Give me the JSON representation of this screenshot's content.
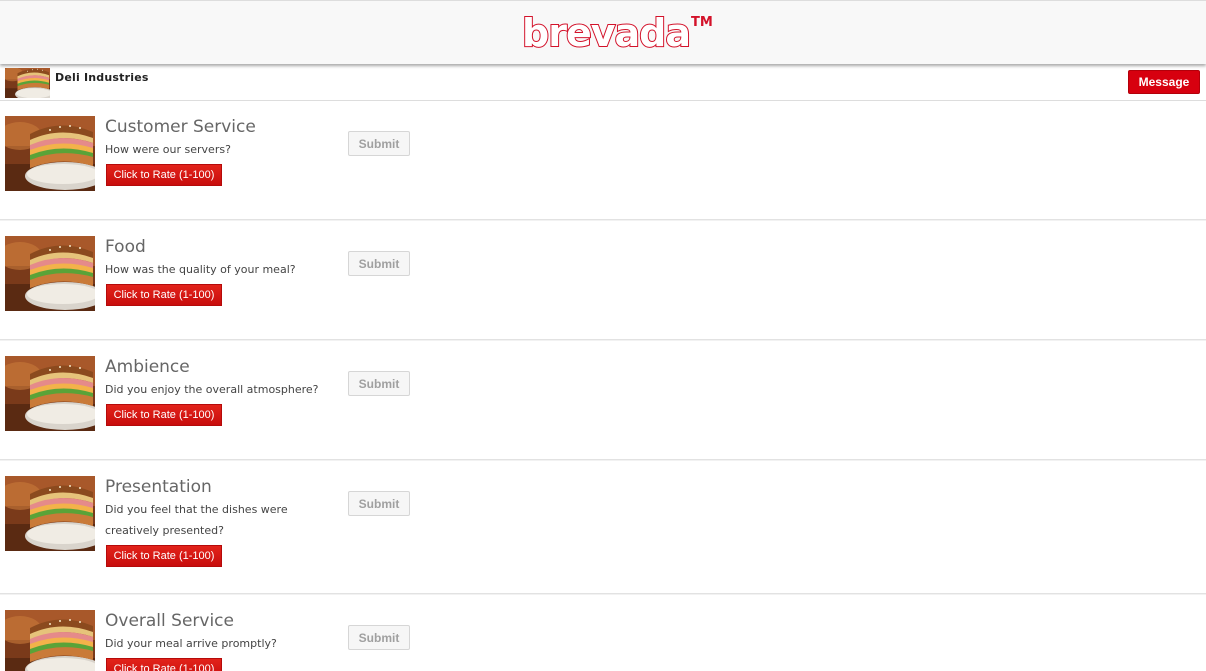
{
  "header": {
    "logo_text": "brevada",
    "logo_tm": "TM"
  },
  "business": {
    "name": "Deli Industries",
    "message_label": "Message"
  },
  "colors": {
    "brand_red": "#d3122a",
    "button_red": "#d7000f",
    "submit_gray": "#a0a0a0"
  },
  "items": [
    {
      "title": "Customer Service",
      "question": "How were our servers?",
      "rate_label": "Click to Rate (1-100)",
      "submit_label": "Submit"
    },
    {
      "title": "Food",
      "question": "How was the quality of your meal?",
      "rate_label": "Click to Rate (1-100)",
      "submit_label": "Submit"
    },
    {
      "title": "Ambience",
      "question": "Did you enjoy the overall atmosphere?",
      "rate_label": "Click to Rate (1-100)",
      "submit_label": "Submit"
    },
    {
      "title": "Presentation",
      "question": "Did you feel that the dishes were creatively presented?",
      "rate_label": "Click to Rate (1-100)",
      "submit_label": "Submit"
    },
    {
      "title": "Overall Service",
      "question": "Did your meal arrive promptly?",
      "rate_label": "Click to Rate (1-100)",
      "submit_label": "Submit"
    }
  ]
}
